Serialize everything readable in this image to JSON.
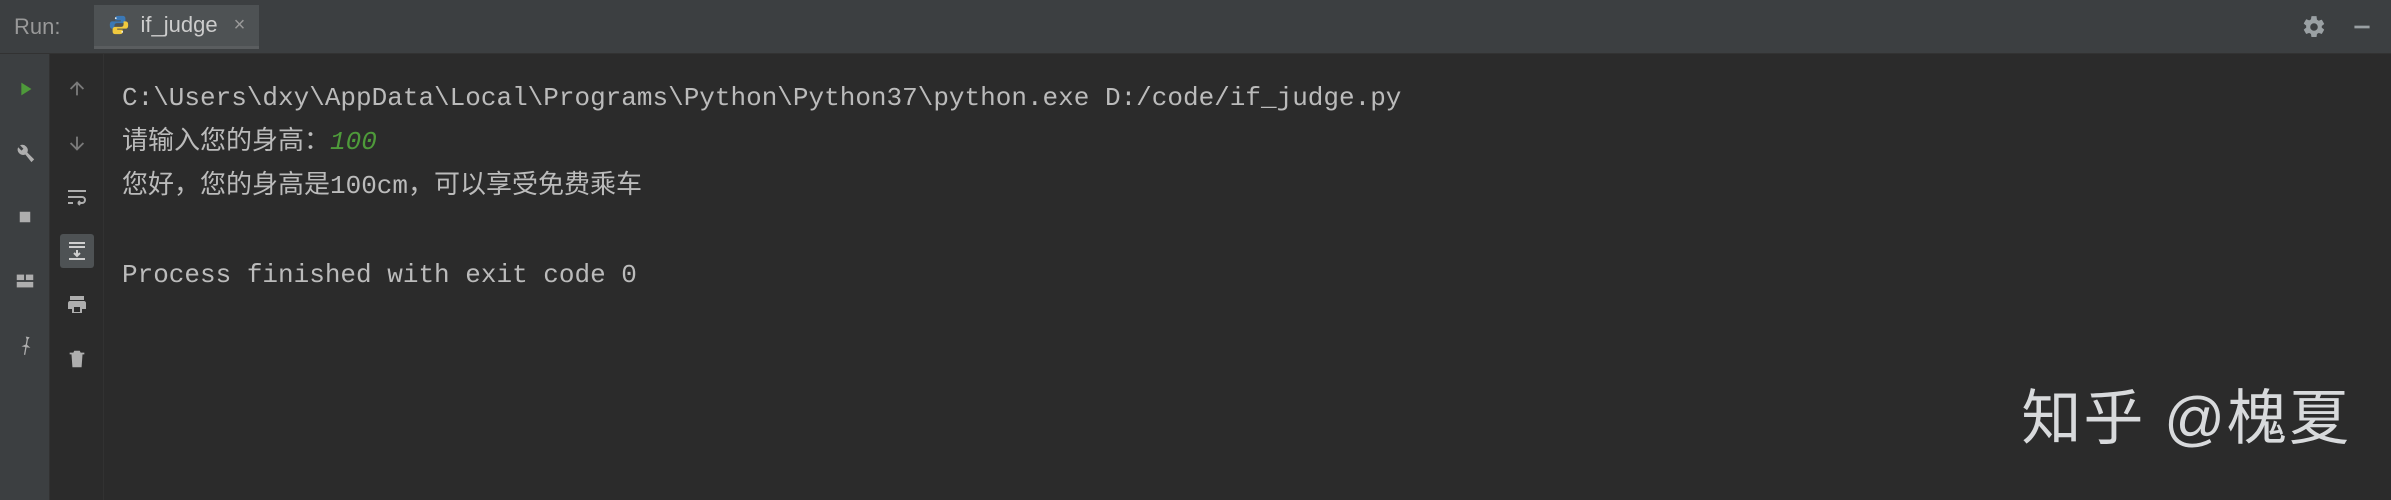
{
  "header": {
    "panel_label": "Run:",
    "tab_label": "if_judge"
  },
  "console": {
    "line1": "C:\\Users\\dxy\\AppData\\Local\\Programs\\Python\\Python37\\python.exe D:/code/if_judge.py",
    "line2_prompt": "请输入您的身高：",
    "line2_input": "100",
    "line3": "您好，您的身高是100cm，可以享受免费乘车",
    "line4": "Process finished with exit code 0"
  },
  "watermark": "知乎 @槐夏"
}
